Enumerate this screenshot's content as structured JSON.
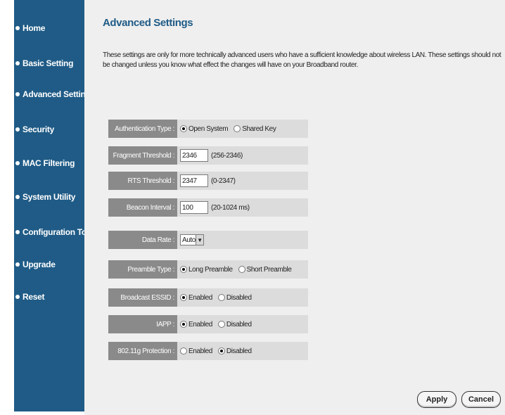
{
  "sidebar": {
    "items": [
      {
        "label": "Home"
      },
      {
        "label": "Basic Setting"
      },
      {
        "label": "Advanced Setting"
      },
      {
        "label": "Security"
      },
      {
        "label": "MAC Filtering"
      },
      {
        "label": "System Utility"
      },
      {
        "label": "Configuration Tool"
      },
      {
        "label": "Upgrade"
      },
      {
        "label": "Reset"
      }
    ]
  },
  "main": {
    "title": "Advanced Settings",
    "description": "These settings are only for more technically advanced users who have a sufficient knowledge about wireless LAN. These settings should not be changed unless you know what effect the changes will have on your Broadband router."
  },
  "form": {
    "auth_type": {
      "label": "Authentication Type :",
      "options": [
        "Open System",
        "Shared Key"
      ],
      "selected": "Open System"
    },
    "fragment": {
      "label": "Fragment Threshold :",
      "value": "2346",
      "hint": "(256-2346)"
    },
    "rts": {
      "label": "RTS Threshold :",
      "value": "2347",
      "hint": "(0-2347)"
    },
    "beacon": {
      "label": "Beacon Interval :",
      "value": "100",
      "hint": "(20-1024 ms)"
    },
    "data_rate": {
      "label": "Data Rate :",
      "value": "Auto"
    },
    "preamble": {
      "label": "Preamble Type :",
      "options": [
        "Long Preamble",
        "Short Preamble"
      ],
      "selected": "Long Preamble"
    },
    "essid": {
      "label": "Broadcast ESSID :",
      "options": [
        "Enabled",
        "Disabled"
      ],
      "selected": "Enabled"
    },
    "iapp": {
      "label": "IAPP :",
      "options": [
        "Enabled",
        "Disabled"
      ],
      "selected": "Enabled"
    },
    "protection": {
      "label": "802.11g Protection :",
      "options": [
        "Enabled",
        "Disabled"
      ],
      "selected": "Disabled"
    }
  },
  "buttons": {
    "apply": "Apply",
    "cancel": "Cancel"
  },
  "colors": {
    "sidebar": "#1f5b86",
    "label_cell": "#8a8a8a",
    "value_cell": "#dcdcdc",
    "background": "#efefef"
  }
}
